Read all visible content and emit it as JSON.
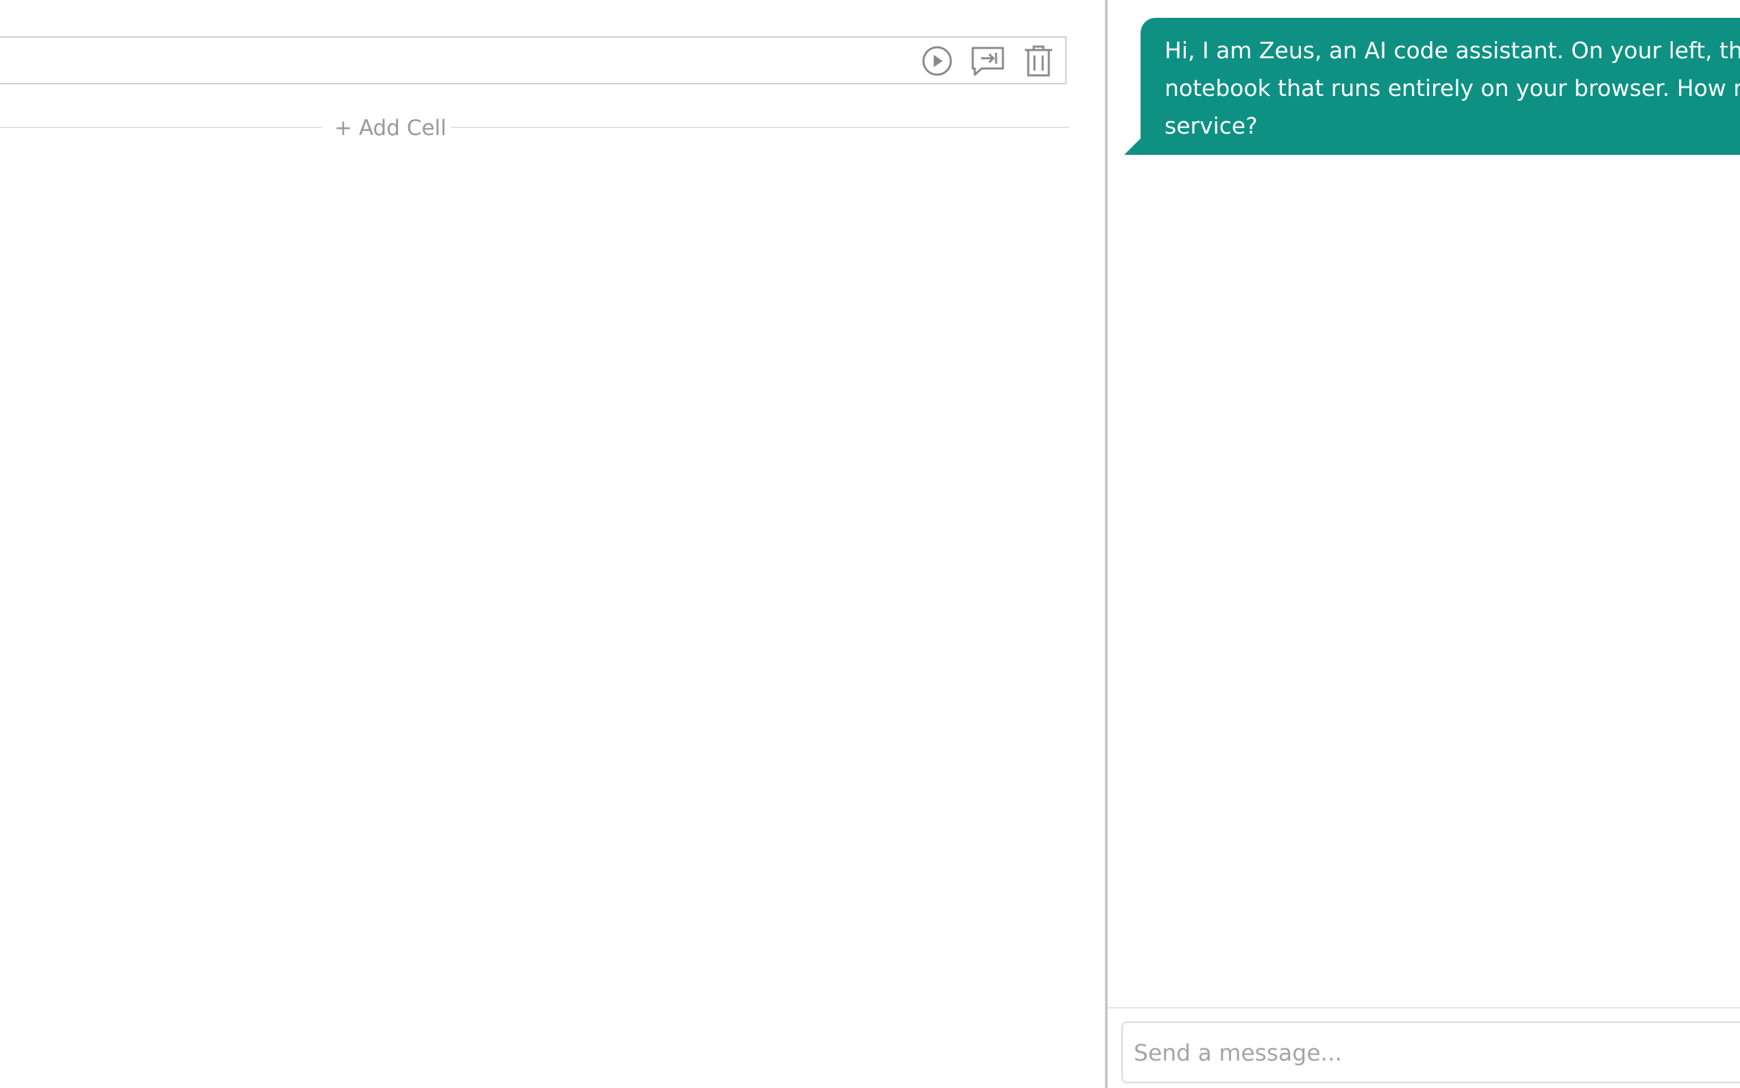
{
  "notebook": {
    "cell_toolbar": {
      "run_icon": "play-circle-icon",
      "ask_icon": "comment-arrow-icon",
      "delete_icon": "trash-icon"
    },
    "add_cell_label": "+ Add Cell"
  },
  "chat": {
    "messages": [
      {
        "sender": "assistant",
        "lines": [
          "Hi, I am Zeus, an AI code assistant. On your left, ther",
          "notebook that runs entirely on your browser. How m",
          "service?"
        ]
      }
    ],
    "composer": {
      "placeholder": "Send a message..."
    }
  },
  "colors": {
    "bubble_background": "#0e9183",
    "bubble_text": "#ffffff",
    "icon_gray": "#8a8a8a",
    "border_gray": "#cfcfcf"
  }
}
